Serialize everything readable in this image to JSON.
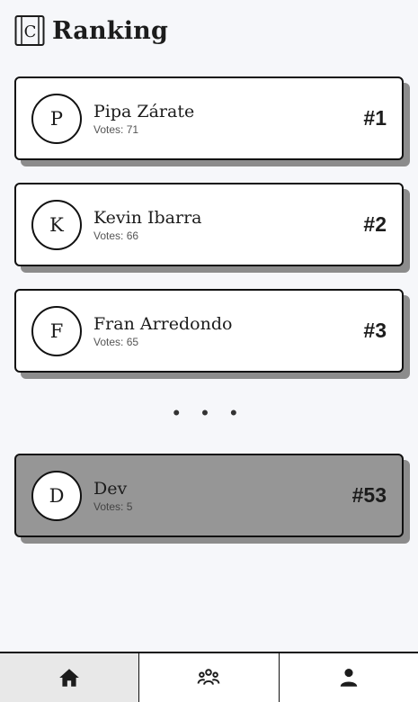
{
  "header": {
    "title": "Ranking",
    "logo_icon": "book-logo-icon",
    "logo_letter": "C"
  },
  "ranking": [
    {
      "initial": "P",
      "name": "Pipa Zárate",
      "votes": "Votes: 71",
      "rank": "#1"
    },
    {
      "initial": "K",
      "name": "Kevin Ibarra",
      "votes": "Votes: 66",
      "rank": "#2"
    },
    {
      "initial": "F",
      "name": "Fran Arredondo",
      "votes": "Votes: 65",
      "rank": "#3"
    }
  ],
  "separator": "• • •",
  "current_user": {
    "initial": "D",
    "name": "Dev",
    "votes": "Votes: 5",
    "rank": "#53"
  },
  "navbar": {
    "items": [
      {
        "icon": "home-icon",
        "active": true
      },
      {
        "icon": "group-icon",
        "active": false
      },
      {
        "icon": "person-icon",
        "active": false
      }
    ]
  },
  "colors": {
    "background": "#f6f7fa",
    "card": "#ffffff",
    "current_user_card": "#969696",
    "shadow": "#8c8c8c",
    "border": "#111111"
  }
}
